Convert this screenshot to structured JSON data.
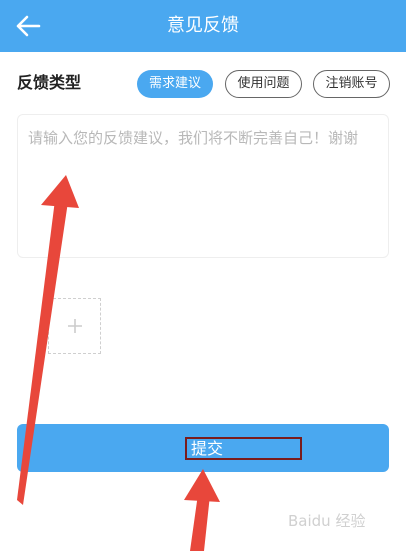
{
  "header": {
    "title": "意见反馈",
    "back_icon": "arrow-left-icon"
  },
  "feedback": {
    "type_label": "反馈类型",
    "types": [
      {
        "label": "需求建议",
        "selected": true
      },
      {
        "label": "使用问题",
        "selected": false
      },
      {
        "label": "注销账号",
        "selected": false
      }
    ],
    "placeholder": "请输入您的反馈建议，我们将不断完善自己！谢谢",
    "upload_icon": "plus-icon"
  },
  "submit": {
    "label": "提交"
  },
  "watermark": {
    "text": "Baidu 经验"
  },
  "colors": {
    "accent": "#4aa8f0",
    "annotation": "#e8473b",
    "highlight_box": "#7a1c1c"
  }
}
